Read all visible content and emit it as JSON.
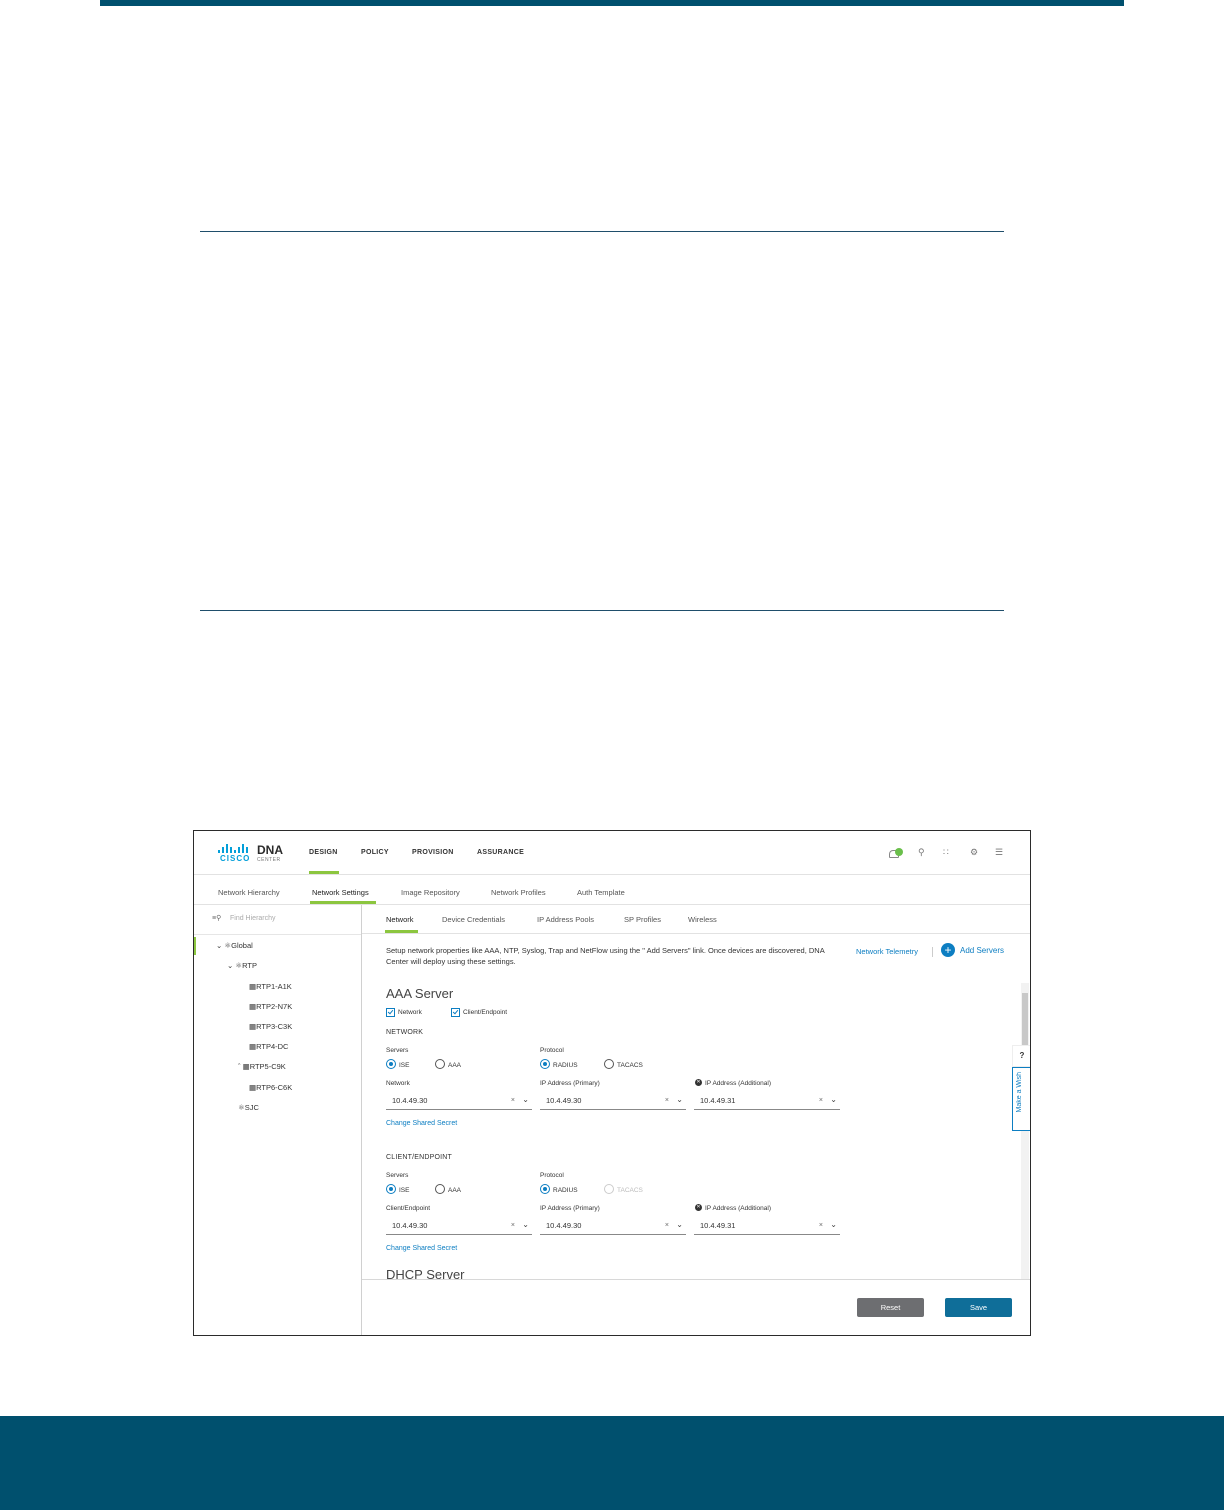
{
  "app": {
    "brand": "CISCO",
    "product": "DNA",
    "product_sub": "CENTER",
    "nav": [
      "DESIGN",
      "POLICY",
      "PROVISION",
      "ASSURANCE"
    ]
  },
  "subnav": [
    "Network Hierarchy",
    "Network Settings",
    "Image Repository",
    "Network Profiles",
    "Auth Template"
  ],
  "sidebar": {
    "search_placeholder": "Find Hierarchy",
    "tree": [
      "Global",
      "RTP",
      "RTP1-A1K",
      "RTP2-N7K",
      "RTP3-C3K",
      "RTP4-DC",
      "RTP5-C9K",
      "RTP6-C6K",
      "SJC"
    ]
  },
  "tabs": [
    "Network",
    "Device Credentials",
    "IP Address Pools",
    "SP Profiles",
    "Wireless"
  ],
  "description": "Setup network properties like AAA, NTP, Syslog, Trap and NetFlow using the \" Add Servers\" link. Once devices are discovered, DNA Center will deploy using these settings.",
  "links": {
    "telemetry": "Network Telemetry",
    "add_servers": "Add Servers"
  },
  "aaa": {
    "title": "AAA Server",
    "check_network": "Network",
    "check_client": "Client/Endpoint",
    "network": {
      "heading": "NETWORK",
      "servers_label": "Servers",
      "protocol_label": "Protocol",
      "opt_ise": "ISE",
      "opt_aaa": "AAA",
      "opt_radius": "RADIUS",
      "opt_tacacs": "TACACS",
      "field1_label": "Network",
      "field1_value": "10.4.49.30",
      "field2_label": "IP Address (Primary)",
      "field2_value": "10.4.49.30",
      "field3_label": "IP Address (Additional)",
      "field3_value": "10.4.49.31",
      "change_secret": "Change Shared Secret"
    },
    "client": {
      "heading": "CLIENT/ENDPOINT",
      "servers_label": "Servers",
      "protocol_label": "Protocol",
      "opt_ise": "ISE",
      "opt_aaa": "AAA",
      "opt_radius": "RADIUS",
      "opt_tacacs": "TACACS",
      "field1_label": "Client/Endpoint",
      "field1_value": "10.4.49.30",
      "field2_label": "IP Address (Primary)",
      "field2_value": "10.4.49.30",
      "field3_label": "IP Address (Additional)",
      "field3_value": "10.4.49.31",
      "change_secret": "Change Shared Secret"
    }
  },
  "dhcp": {
    "title": "DHCP Server"
  },
  "wish": {
    "question": "?",
    "label": "Make a Wish"
  },
  "buttons": {
    "reset": "Reset",
    "save": "Save"
  },
  "colors": {
    "brand": "#00506e",
    "accent": "#8cc63f",
    "link": "#0d7ec2",
    "save": "#0f6e99",
    "reset": "#6d6e71"
  }
}
